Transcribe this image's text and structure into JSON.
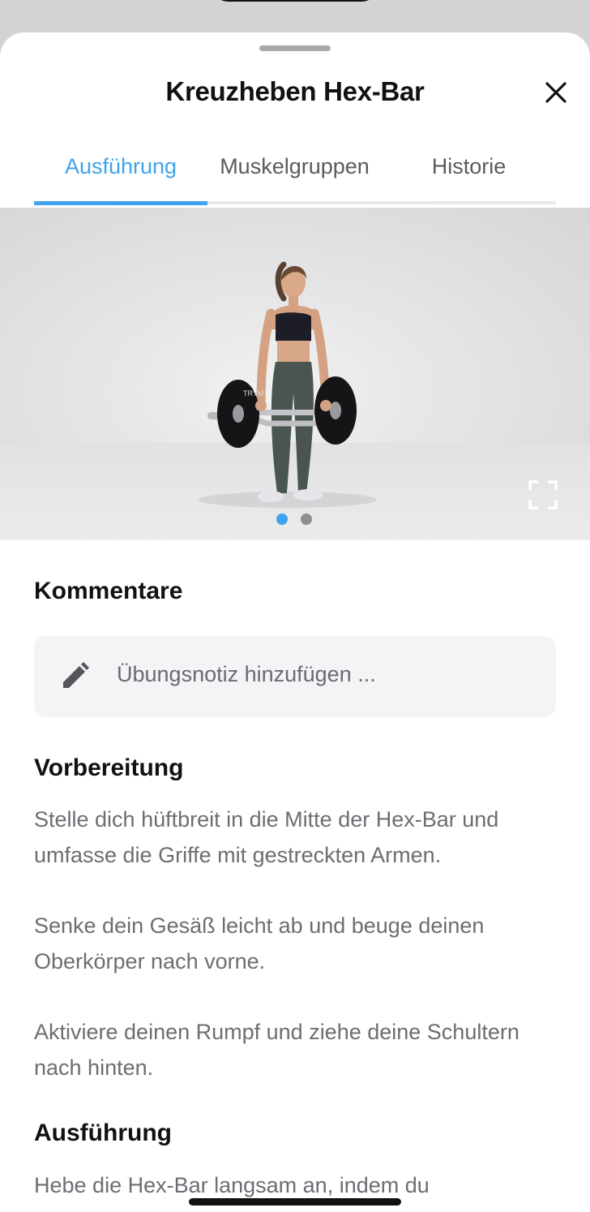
{
  "sheet": {
    "title": "Kreuzheben Hex-Bar"
  },
  "tabs": [
    {
      "label": "Ausführung",
      "active": true
    },
    {
      "label": "Muskelgruppen",
      "active": false
    },
    {
      "label": "Historie",
      "active": false
    }
  ],
  "media": {
    "page_count": 2,
    "active_page": 1,
    "plate_text": "TRYM"
  },
  "comments": {
    "title": "Kommentare",
    "placeholder": "Übungsnotiz hinzufügen ..."
  },
  "preparation": {
    "title": "Vorbereitung",
    "steps": [
      "Stelle dich hüftbreit in die Mitte der Hex-Bar und umfasse die Griffe mit gestreckten Armen.",
      "Senke dein Gesäß leicht ab und beuge deinen Oberkörper nach vorne.",
      "Aktiviere deinen Rumpf und ziehe deine Schultern nach hinten."
    ]
  },
  "execution": {
    "title": "Ausführung",
    "steps": [
      "Hebe die Hex-Bar langsam an, indem du"
    ]
  },
  "colors": {
    "accent": "#3fa2ec",
    "inactive_dot": "#8e8e93"
  }
}
